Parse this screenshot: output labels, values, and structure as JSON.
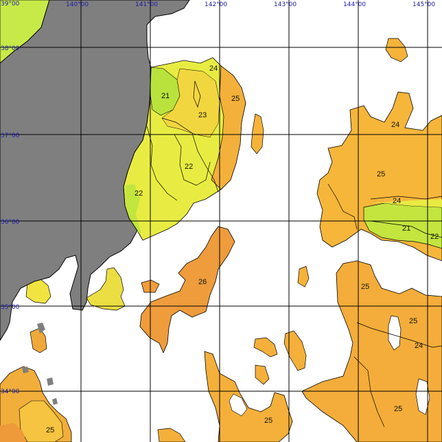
{
  "map": {
    "longitude_labels": [
      "140°00",
      "141°00",
      "142°00",
      "143°00",
      "144°00",
      "145°00"
    ],
    "latitude_labels": [
      "39°00",
      "38°00",
      "37°00",
      "36°00",
      "35°00",
      "34°00"
    ],
    "isotherm_labels": [
      "24",
      "21",
      "25",
      "23",
      "22",
      "22",
      "24",
      "25",
      "24",
      "21",
      "22",
      "26",
      "25",
      "25",
      "24",
      "25",
      "25",
      "25"
    ],
    "colors": {
      "land": "#7f7f7f",
      "sst_21": "#b8e838",
      "sst_22": "#e2ee40",
      "sst_23": "#f0e040",
      "sst_24": "#f7c840",
      "sst_25": "#f5b23a",
      "sst_26": "#ef9a3a",
      "grid": "#000000",
      "label": "#1a1aa8"
    }
  }
}
